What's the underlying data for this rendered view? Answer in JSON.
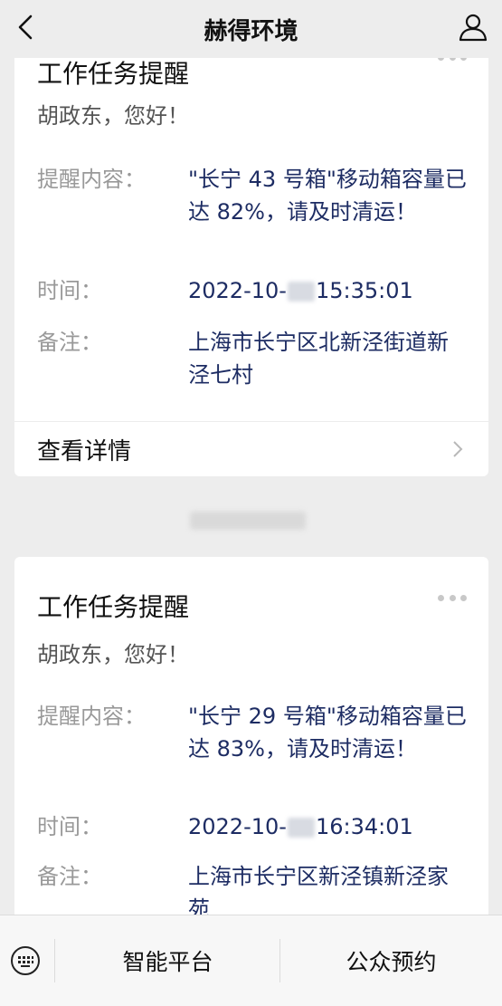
{
  "header": {
    "title": "赫得环境",
    "back_icon": "chevron-left-icon",
    "profile_icon": "user-icon"
  },
  "cards": [
    {
      "title": "工作任务提醒",
      "greeting": "胡政东，您好！",
      "content_label": "提醒内容：",
      "content_value": "\"长宁 43 号箱\"移动箱容量已达 82%，请及时清运！",
      "time_label": "时间：",
      "time_prefix": "2022-10-",
      "time_suffix": "15:35:01",
      "note_label": "备注：",
      "note_value": "上海市长宁区北新泾街道新泾七村",
      "detail_label": "查看详情"
    },
    {
      "title": "工作任务提醒",
      "greeting": "胡政东，您好！",
      "content_label": "提醒内容：",
      "content_value": "\"长宁 29 号箱\"移动箱容量已达 83%，请及时清运！",
      "time_label": "时间：",
      "time_prefix": "2022-10-",
      "time_suffix": "16:34:01",
      "note_label": "备注：",
      "note_value": "上海市长宁区新泾镇新泾家苑"
    }
  ],
  "bottom_menu": {
    "keyboard_icon": "keyboard-icon",
    "items": [
      "智能平台",
      "公众预约"
    ]
  }
}
